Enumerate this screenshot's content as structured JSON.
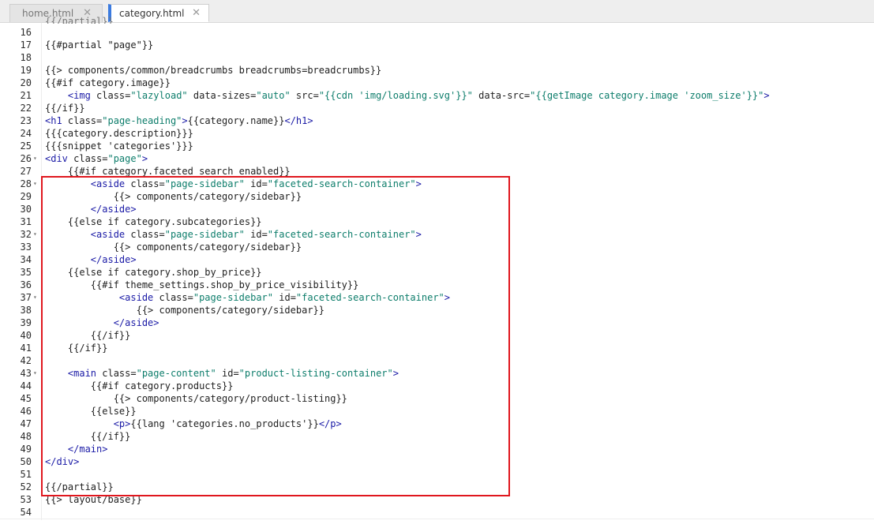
{
  "tabs": [
    {
      "label": "home.html",
      "active": false
    },
    {
      "label": "category.html",
      "active": true
    }
  ],
  "close_glyph": "✕",
  "fold_glyph": "▾",
  "code_lines": [
    {
      "n": "16",
      "text": ""
    },
    {
      "n": "17",
      "text": "{{#partial \"page\"}}"
    },
    {
      "n": "18",
      "text": ""
    },
    {
      "n": "19",
      "text": "{{> components/common/breadcrumbs breadcrumbs=breadcrumbs}}"
    },
    {
      "n": "20",
      "text": "{{#if category.image}}"
    },
    {
      "n": "21",
      "text": "    <img class=\"lazyload\" data-sizes=\"auto\" src=\"{{cdn 'img/loading.svg'}}\" data-src=\"{{getImage category.image 'zoom_size'}}\">"
    },
    {
      "n": "22",
      "text": "{{/if}}"
    },
    {
      "n": "23",
      "text": "<h1 class=\"page-heading\">{{category.name}}</h1>"
    },
    {
      "n": "24",
      "text": "{{{category.description}}}"
    },
    {
      "n": "25",
      "text": "{{{snippet 'categories'}}}"
    },
    {
      "n": "26",
      "text": "<div class=\"page\">",
      "fold": true
    },
    {
      "n": "27",
      "text": "    {{#if category.faceted_search_enabled}}"
    },
    {
      "n": "28",
      "text": "        <aside class=\"page-sidebar\" id=\"faceted-search-container\">",
      "fold": true
    },
    {
      "n": "29",
      "text": "            {{> components/category/sidebar}}"
    },
    {
      "n": "30",
      "text": "        </aside>"
    },
    {
      "n": "31",
      "text": "    {{else if category.subcategories}}"
    },
    {
      "n": "32",
      "text": "        <aside class=\"page-sidebar\" id=\"faceted-search-container\">",
      "fold": true
    },
    {
      "n": "33",
      "text": "            {{> components/category/sidebar}}"
    },
    {
      "n": "34",
      "text": "        </aside>"
    },
    {
      "n": "35",
      "text": "    {{else if category.shop_by_price}}"
    },
    {
      "n": "36",
      "text": "        {{#if theme_settings.shop_by_price_visibility}}"
    },
    {
      "n": "37",
      "text": "             <aside class=\"page-sidebar\" id=\"faceted-search-container\">",
      "fold": true
    },
    {
      "n": "38",
      "text": "                {{> components/category/sidebar}}"
    },
    {
      "n": "39",
      "text": "            </aside>"
    },
    {
      "n": "40",
      "text": "        {{/if}}"
    },
    {
      "n": "41",
      "text": "    {{/if}}"
    },
    {
      "n": "42",
      "text": ""
    },
    {
      "n": "43",
      "text": "    <main class=\"page-content\" id=\"product-listing-container\">",
      "fold": true
    },
    {
      "n": "44",
      "text": "        {{#if category.products}}"
    },
    {
      "n": "45",
      "text": "            {{> components/category/product-listing}}"
    },
    {
      "n": "46",
      "text": "        {{else}}"
    },
    {
      "n": "47",
      "text": "            <p>{{lang 'categories.no_products'}}</p>"
    },
    {
      "n": "48",
      "text": "        {{/if}}"
    },
    {
      "n": "49",
      "text": "    </main>"
    },
    {
      "n": "50",
      "text": "</div>"
    },
    {
      "n": "51",
      "text": ""
    },
    {
      "n": "52",
      "text": "{{/partial}}"
    },
    {
      "n": "53",
      "text": "{{> layout/base}}"
    },
    {
      "n": "54",
      "text": ""
    }
  ],
  "partial_top_text": "{{/partial}}"
}
